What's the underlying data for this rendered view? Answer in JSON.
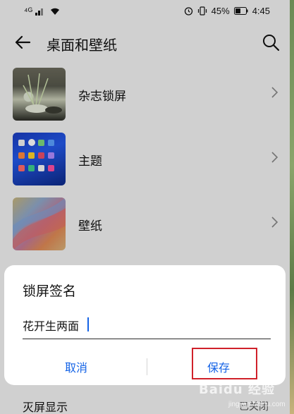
{
  "status_bar": {
    "network": "⁴ᴳ",
    "battery": "45%",
    "time": "4:45"
  },
  "header": {
    "title": "桌面和壁纸",
    "back_icon": "arrow-left-icon",
    "search_icon": "search-icon"
  },
  "settings": [
    {
      "label": "杂志锁屏"
    },
    {
      "label": "主题"
    },
    {
      "label": "壁纸"
    }
  ],
  "bottom_row": {
    "label": "灭屏显示",
    "value": "已关闭"
  },
  "dialog": {
    "title": "锁屏签名",
    "input_value": "花开生两面",
    "cancel_label": "取消",
    "save_label": "保存"
  },
  "watermark": {
    "text": "Baidu 经验",
    "sub": "jingyan.baidu.com"
  },
  "colors": {
    "accent": "#1463e6",
    "highlight": "#d0212a"
  }
}
